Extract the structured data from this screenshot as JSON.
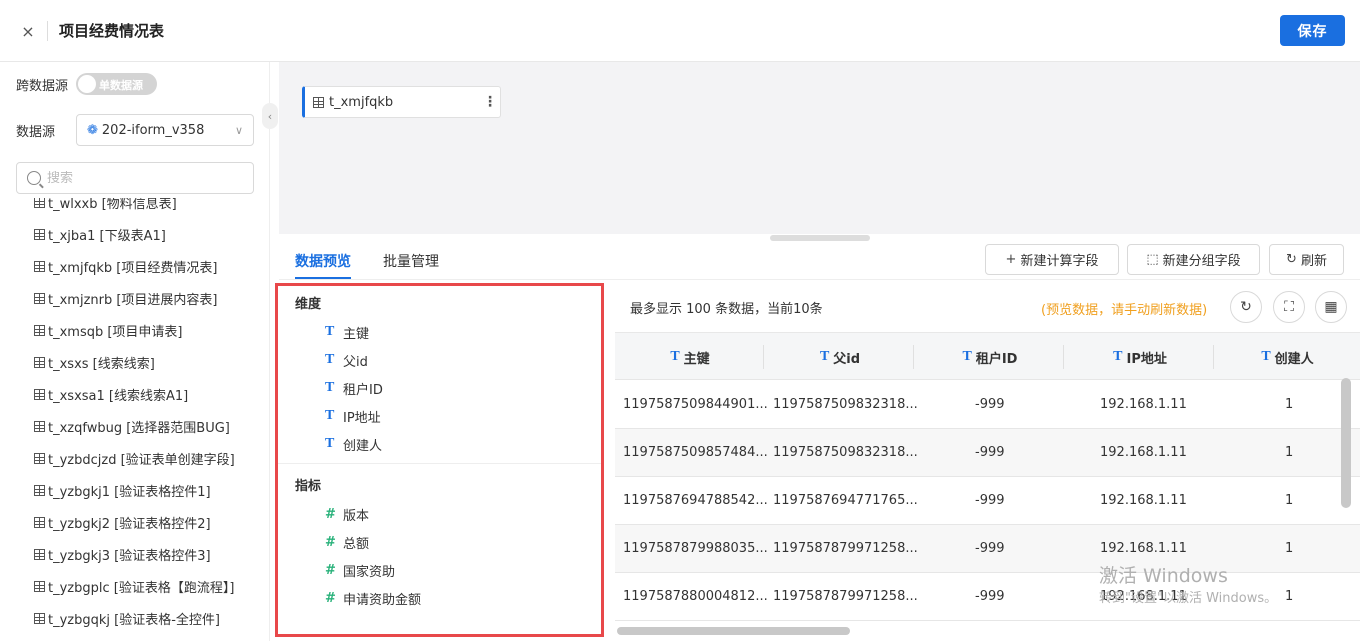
{
  "header": {
    "close_icon": "×",
    "title": "项目经费情况表",
    "save_label": "保存"
  },
  "sidebar": {
    "cross_source_label": "跨数据源",
    "toggle_label": "单数据源",
    "datasource_label": "数据源",
    "datasource_value": "202-iform_v358",
    "search_placeholder": "搜索",
    "tables": [
      "t_wlxxb [物料信息表]",
      "t_xjba1 [下级表A1]",
      "t_xmjfqkb [项目经费情况表]",
      "t_xmjznrb [项目进展内容表]",
      "t_xmsqb [项目申请表]",
      "t_xsxs [线索线索]",
      "t_xsxsa1 [线索线索A1]",
      "t_xzqfwbug [选择器范围BUG]",
      "t_yzbdcjzd [验证表单创建字段]",
      "t_yzbgkj1 [验证表格控件1]",
      "t_yzbgkj2 [验证表格控件2]",
      "t_yzbgkj3 [验证表格控件3]",
      "t_yzbgplc [验证表格【跑流程】]",
      "t_yzbgqkj [验证表格-全控件]"
    ]
  },
  "canvas": {
    "node_name": "t_xmjfqkb"
  },
  "panel": {
    "tabs": [
      "数据预览",
      "批量管理"
    ],
    "buttons": {
      "new_calc": "新建计算字段",
      "new_group": "新建分组字段",
      "refresh": "刷新"
    },
    "info": "最多显示 100 条数据，当前10条",
    "warning": "(预览数据，请手动刷新数据)"
  },
  "fields": {
    "dimension_title": "维度",
    "dimensions": [
      "主键",
      "父id",
      "租户ID",
      "IP地址",
      "创建人"
    ],
    "measure_title": "指标",
    "measures": [
      "版本",
      "总额",
      "国家资助",
      "申请资助金额"
    ]
  },
  "grid": {
    "columns": [
      "主键",
      "父id",
      "租户ID",
      "IP地址",
      "创建人"
    ],
    "rows": [
      [
        "1197587509844901...",
        "1197587509832318...",
        "-999",
        "192.168.1.11",
        "1"
      ],
      [
        "1197587509857484...",
        "1197587509832318...",
        "-999",
        "192.168.1.11",
        "1"
      ],
      [
        "1197587694788542...",
        "1197587694771765...",
        "-999",
        "192.168.1.11",
        "1"
      ],
      [
        "1197587879988035...",
        "1197587879971258...",
        "-999",
        "192.168.1.11",
        "1"
      ],
      [
        "1197587880004812...",
        "1197587879971258...",
        "-999",
        "192.168.1.11",
        "1"
      ]
    ]
  },
  "watermark": {
    "line1": "激活 Windows",
    "line2": "转到\"设置\"以激活 Windows。"
  },
  "colors": {
    "accent": "#1a6fe0",
    "highlight_border": "#e8484a",
    "warning": "#f0a020",
    "measure_icon": "#2ab27b"
  }
}
